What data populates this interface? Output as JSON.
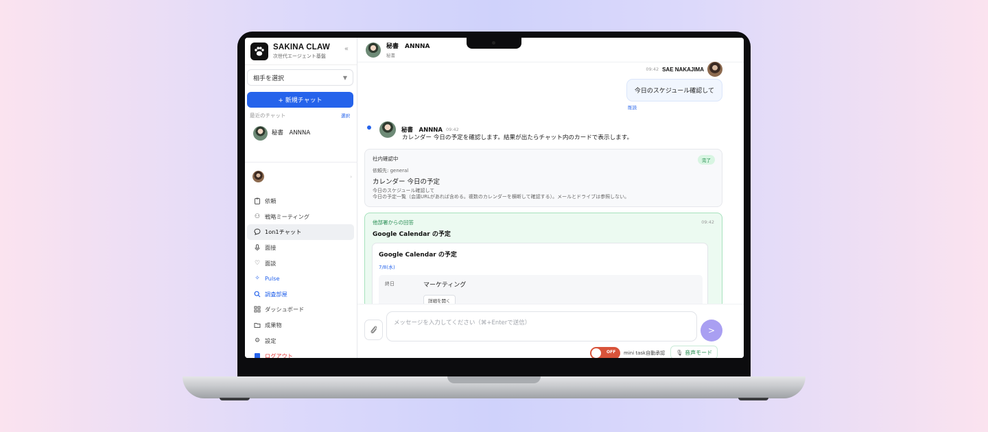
{
  "app": {
    "brand_name": "SAKINA CLAW",
    "brand_subtitle": "次世代エージェント基盤",
    "collapse_icon": "«"
  },
  "sidebar": {
    "partner_select": "相手を選択",
    "new_chat": "+ 新規チャット",
    "recent_label": "最近のチャット",
    "select_label": "選択",
    "recent_chats": [
      {
        "name": "秘書　ANNNA"
      }
    ],
    "nav_items": [
      {
        "label": "依頼",
        "icon": "clipboard-icon"
      },
      {
        "label": "戦略ミーティング",
        "icon": "people-icon"
      },
      {
        "label": "1on1チャット",
        "icon": "chat-bubble-icon",
        "active": true
      },
      {
        "label": "面接",
        "icon": "microphone-icon"
      },
      {
        "label": "面談",
        "icon": "heart-icon"
      },
      {
        "label": "Pulse",
        "icon": "pulse-icon",
        "color": "#2563eb"
      },
      {
        "label": "調査部屋",
        "icon": "search-icon",
        "color": "#2563eb"
      },
      {
        "label": "ダッシュボード",
        "icon": "grid-icon"
      },
      {
        "label": "成果物",
        "icon": "folder-icon"
      },
      {
        "label": "設定",
        "icon": "gear-icon"
      },
      {
        "label": "ログアウト",
        "icon": "logout-icon",
        "color": "#e23b3b"
      }
    ]
  },
  "chat": {
    "header_name": "秘書　ANNNA",
    "header_role": "秘書",
    "user_message": {
      "time": "09:42",
      "sender": "SAE NAKAJIMA",
      "text": "今日のスケジュール確認して",
      "status": "既読"
    },
    "bot_message": {
      "sender": "秘書　ANNNA",
      "time": "09:42",
      "text": "カレンダー 今日の予定を確認します。結果が出たらチャット内のカードで表示します。"
    },
    "internal_card": {
      "label": "社内確認中",
      "badge": "完了",
      "destination": "依頼先: general",
      "title": "カレンダー 今日の予定",
      "desc1": "今日のスケジュール確認して",
      "desc2": "今日の予定一覧（会議URLがあれば含める。複数のカレンダーを横断して確認する）。メールとドライブは参照しない。"
    },
    "reply_card": {
      "from": "他部署からの回答",
      "time": "09:42",
      "title": "Google Calendar の予定",
      "inner_title": "Google Calendar の予定",
      "date": "7/8(水)",
      "event_allday": "終日",
      "event_title": "マーケティング",
      "details_button": "詳細を開く"
    },
    "composer": {
      "placeholder": "メッセージを入力してください（⌘+Enterで送信）",
      "value": "",
      "send_icon": ">",
      "toggle_state": "OFF",
      "auto_label": "mini task自動承認",
      "voice_button": "音声モード"
    }
  },
  "colors": {
    "accent": "#2563eb",
    "success": "#1e8a4a",
    "danger": "#e23b3b",
    "send_button": "#a99ff2",
    "toggle_off": "#d8533a"
  }
}
